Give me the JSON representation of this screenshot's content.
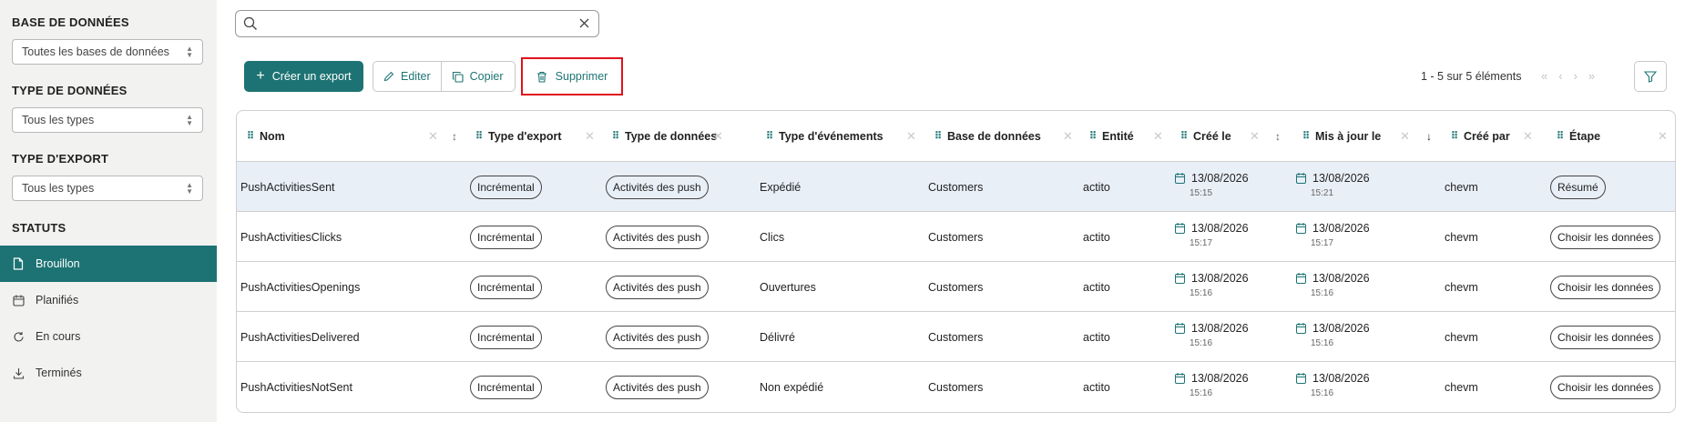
{
  "sidebar": {
    "database_label": "BASE DE DONNÉES",
    "database_value": "Toutes les bases de données",
    "datatype_label": "TYPE DE DONNÉES",
    "datatype_value": "Tous les types",
    "exporttype_label": "TYPE D'EXPORT",
    "exporttype_value": "Tous les types",
    "status_label": "STATUTS",
    "items": [
      {
        "label": "Brouillon",
        "icon": "file-icon",
        "active": true
      },
      {
        "label": "Planifiés",
        "icon": "calendar-icon",
        "active": false
      },
      {
        "label": "En cours",
        "icon": "refresh-icon",
        "active": false
      },
      {
        "label": "Terminés",
        "icon": "download-icon",
        "active": false
      }
    ]
  },
  "search": {
    "value": "",
    "placeholder": ""
  },
  "toolbar": {
    "create_label": "Créer un export",
    "edit_label": "Editer",
    "copy_label": "Copier",
    "delete_label": "Supprimer"
  },
  "pagination": {
    "info": "1 - 5 sur 5 éléments"
  },
  "colors": {
    "accent": "#1d7373",
    "highlight": "#e0121b",
    "selected_row": "#e9eff7"
  },
  "table": {
    "headers": {
      "name": "Nom",
      "export_type": "Type d'export",
      "data_type": "Type de données",
      "event_type": "Type d'événements",
      "database": "Base de données",
      "entity": "Entité",
      "created": "Créé le",
      "updated": "Mis à jour le",
      "created_by": "Créé par",
      "step": "Étape"
    },
    "rows": [
      {
        "name": "PushActivitiesSent",
        "export_type": "Incrémental",
        "data_type": "Activités des push",
        "event_type": "Expédié",
        "database": "Customers",
        "entity": "actito",
        "created_date": "13/08/2026",
        "created_time": "15:15",
        "updated_date": "13/08/2026",
        "updated_time": "15:21",
        "created_by": "chevm",
        "step": "Résumé"
      },
      {
        "name": "PushActivitiesClicks",
        "export_type": "Incrémental",
        "data_type": "Activités des push",
        "event_type": "Clics",
        "database": "Customers",
        "entity": "actito",
        "created_date": "13/08/2026",
        "created_time": "15:17",
        "updated_date": "13/08/2026",
        "updated_time": "15:17",
        "created_by": "chevm",
        "step": "Choisir les données"
      },
      {
        "name": "PushActivitiesOpenings",
        "export_type": "Incrémental",
        "data_type": "Activités des push",
        "event_type": "Ouvertures",
        "database": "Customers",
        "entity": "actito",
        "created_date": "13/08/2026",
        "created_time": "15:16",
        "updated_date": "13/08/2026",
        "updated_time": "15:16",
        "created_by": "chevm",
        "step": "Choisir les données"
      },
      {
        "name": "PushActivitiesDelivered",
        "export_type": "Incrémental",
        "data_type": "Activités des push",
        "event_type": "Délivré",
        "database": "Customers",
        "entity": "actito",
        "created_date": "13/08/2026",
        "created_time": "15:16",
        "updated_date": "13/08/2026",
        "updated_time": "15:16",
        "created_by": "chevm",
        "step": "Choisir les données"
      },
      {
        "name": "PushActivitiesNotSent",
        "export_type": "Incrémental",
        "data_type": "Activités des push",
        "event_type": "Non expédié",
        "database": "Customers",
        "entity": "actito",
        "created_date": "13/08/2026",
        "created_time": "15:16",
        "updated_date": "13/08/2026",
        "updated_time": "15:16",
        "created_by": "chevm",
        "step": "Choisir les données"
      }
    ]
  }
}
